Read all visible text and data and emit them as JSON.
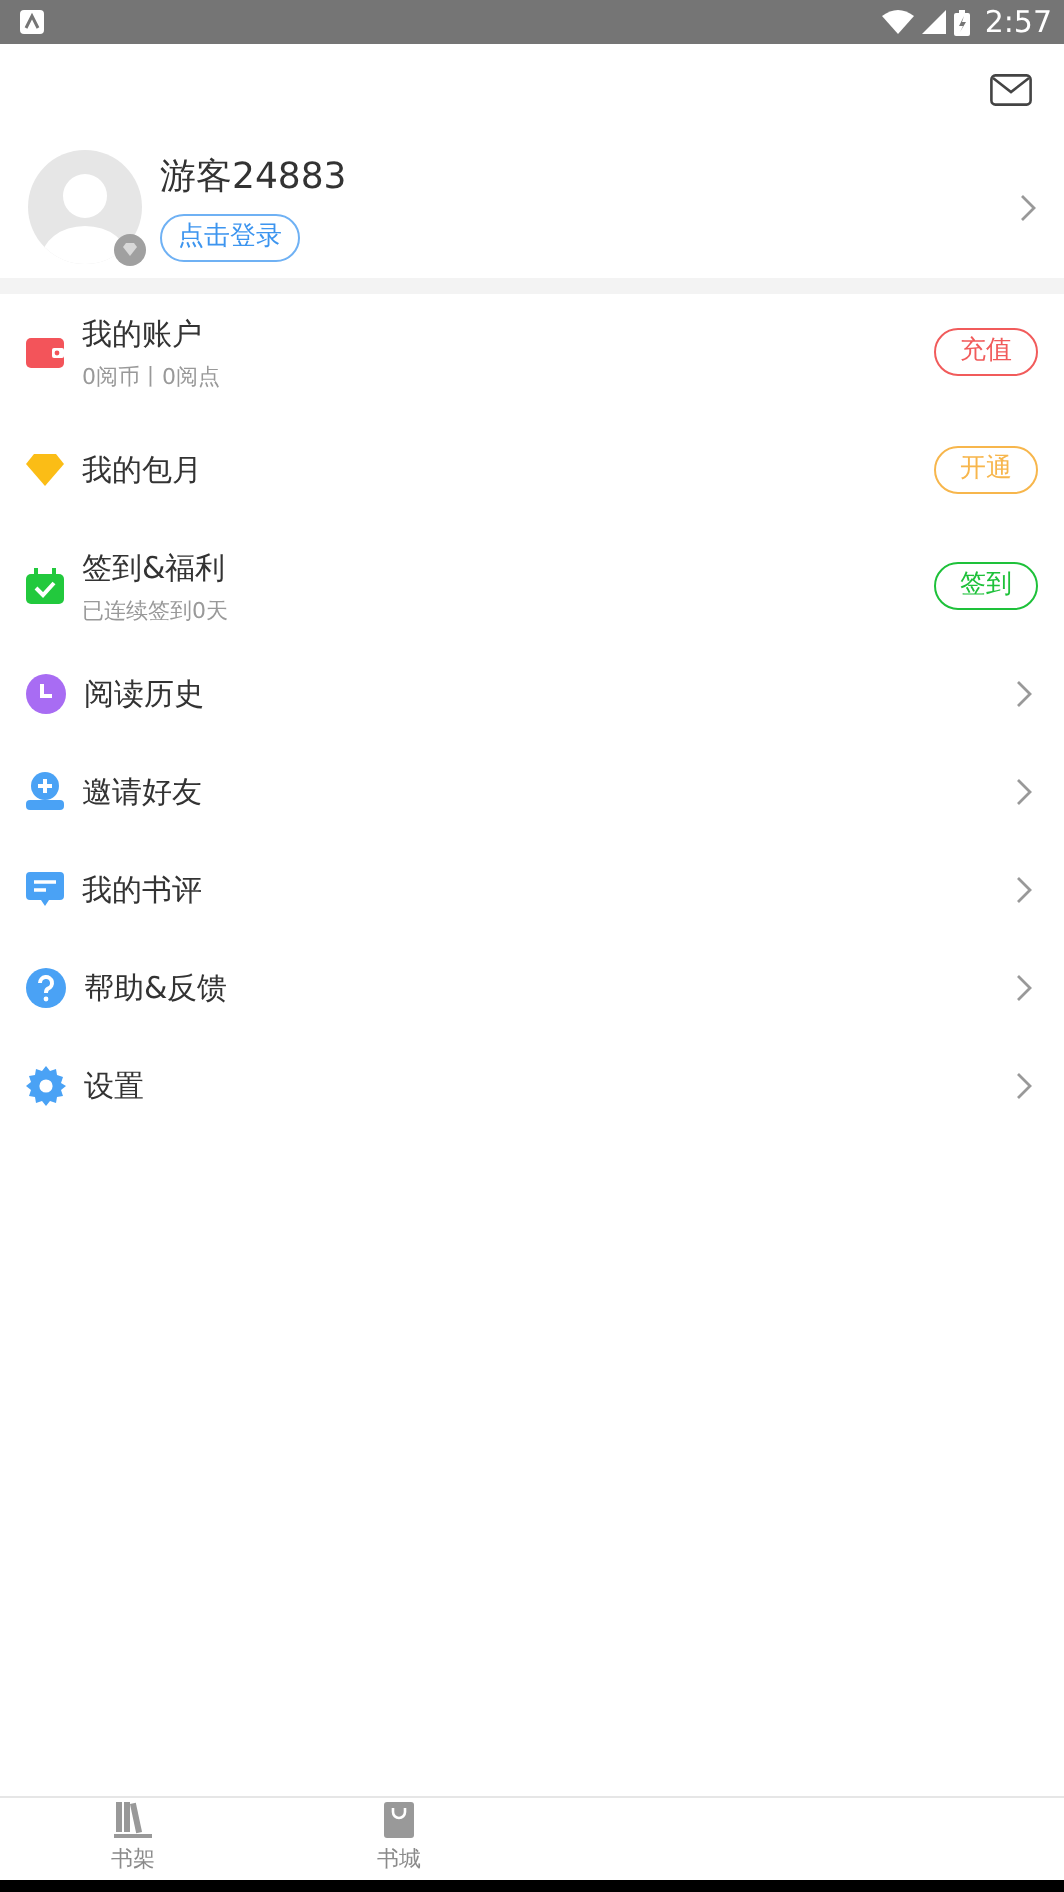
{
  "status_bar": {
    "time": "2:57"
  },
  "profile": {
    "name": "游客24883",
    "login_button": "点击登录"
  },
  "menu": [
    {
      "kind": "action",
      "title": "我的账户",
      "subtitle": "0阅币丨0阅点",
      "button": "充值",
      "color": "#f15b5b"
    },
    {
      "kind": "action",
      "title": "我的包月",
      "button": "开通",
      "color": "#f7b64c"
    },
    {
      "kind": "action",
      "title": "签到&福利",
      "subtitle": "已连续签到0天",
      "button": "签到",
      "color": "#1ec13a"
    },
    {
      "kind": "link",
      "title": "阅读历史"
    },
    {
      "kind": "link",
      "title": "邀请好友"
    },
    {
      "kind": "link",
      "title": "我的书评"
    },
    {
      "kind": "link",
      "title": "帮助&反馈"
    },
    {
      "kind": "link",
      "title": "设置"
    }
  ],
  "bottom_tabs": [
    {
      "label": "书架"
    },
    {
      "label": "书城"
    }
  ]
}
